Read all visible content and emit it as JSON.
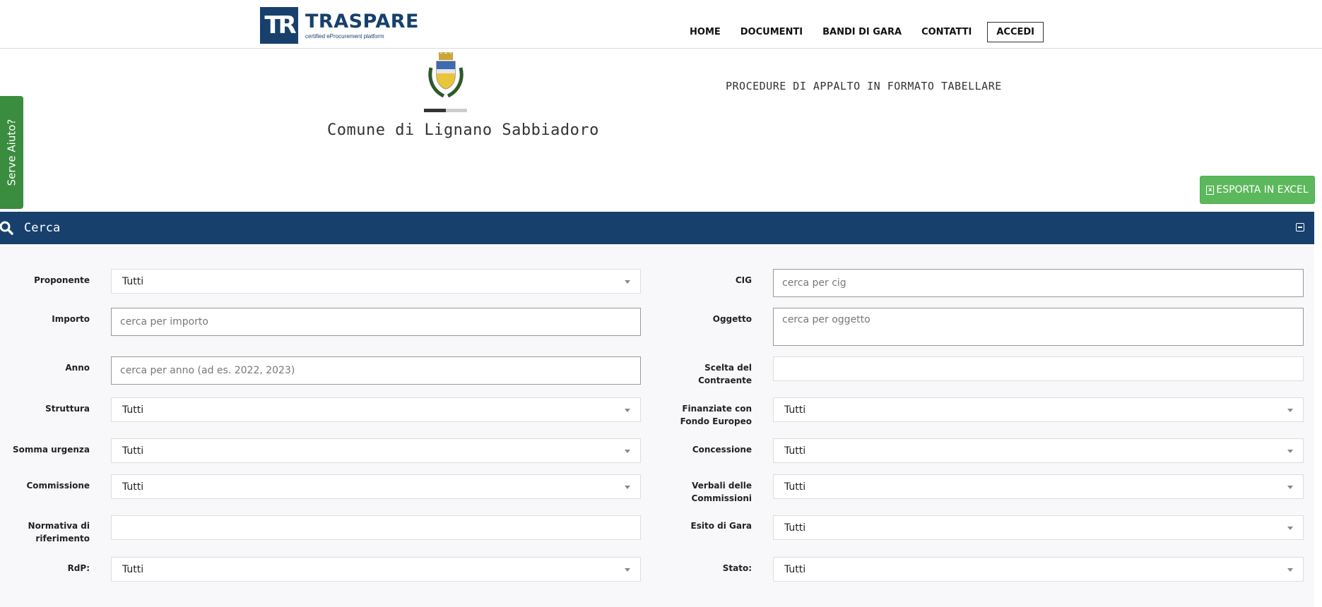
{
  "header": {
    "logo_mark": "TR",
    "logo_name": "TRASPARE",
    "logo_tagline": "certified eProcurement platform",
    "nav": [
      "HOME",
      "DOCUMENTI",
      "BANDI DI GARA",
      "CONTATTI"
    ],
    "login_label": "ACCEDI"
  },
  "help_tab": "Serve Aiuto?",
  "hero": {
    "city": "Comune di Lignano Sabbiadoro",
    "title": "PROCEDURE DI APPALTO IN FORMATO TABELLARE",
    "carousel_progress": 0.5
  },
  "export_label": "ESPORTA IN EXCEL",
  "search": {
    "title": "Cerca",
    "left": [
      {
        "label": "Proponente",
        "type": "select",
        "value": "Tutti"
      },
      {
        "label": "Importo",
        "type": "input",
        "placeholder": "cerca per importo"
      },
      {
        "label": "Anno",
        "type": "input",
        "placeholder": "cerca per anno (ad es. 2022, 2023)"
      },
      {
        "label": "Struttura",
        "type": "select",
        "value": "Tutti"
      },
      {
        "label": "Somma urgenza",
        "type": "select",
        "value": "Tutti"
      },
      {
        "label": "Commissione",
        "type": "select",
        "value": "Tutti"
      },
      {
        "label": "Normativa di riferimento",
        "type": "select",
        "value": ""
      },
      {
        "label": "RdP:",
        "type": "select",
        "value": "Tutti"
      }
    ],
    "right": [
      {
        "label": "CIG",
        "type": "input",
        "placeholder": "cerca per cig"
      },
      {
        "label": "Oggetto",
        "type": "textarea",
        "placeholder": "cerca per oggetto"
      },
      {
        "label": "Scelta del Contraente",
        "type": "select",
        "value": ""
      },
      {
        "label": "Finanziate con Fondo Europeo",
        "type": "select",
        "value": "Tutti"
      },
      {
        "label": "Concessione",
        "type": "select",
        "value": "Tutti"
      },
      {
        "label": "Verbali delle Commissioni",
        "type": "select",
        "value": "Tutti"
      },
      {
        "label": "Esito di Gara",
        "type": "select",
        "value": "Tutti"
      },
      {
        "label": "Stato:",
        "type": "select",
        "value": "Tutti"
      }
    ]
  }
}
